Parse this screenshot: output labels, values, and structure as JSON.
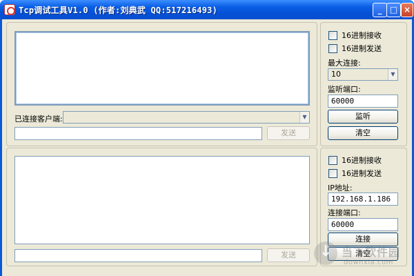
{
  "window": {
    "title": "Tcp调试工具V1.0 (作者:刘典武 QQ:517216493)",
    "controls": {
      "minimize": "_",
      "maximize": "□",
      "close": "×"
    }
  },
  "server": {
    "hex_receive": "16进制接收",
    "hex_send": "16进制发送",
    "max_connections_label": "最大连接:",
    "max_connections_value": "10",
    "listen_port_label": "监听端口:",
    "listen_port_value": "60000",
    "listen_button": "监听",
    "clear_button": "清空",
    "connected_clients_label": "已连接客户端:",
    "connected_clients_value": "",
    "send_input_value": "",
    "send_button": "发送"
  },
  "client": {
    "hex_receive": "16进制接收",
    "hex_send": "16进制发送",
    "ip_label": "IP地址:",
    "ip_value": "192.168.1.186",
    "port_label": "连接端口:",
    "port_value": "60000",
    "connect_button": "连接",
    "clear_button": "清空",
    "send_input_value": "",
    "send_button": "发送"
  },
  "watermark": {
    "name": "当下软件园",
    "url": "downxia.com"
  },
  "colors": {
    "titlebar": "#0a58d8",
    "client_bg": "#ece9d8",
    "input_border": "#7f9db9"
  }
}
